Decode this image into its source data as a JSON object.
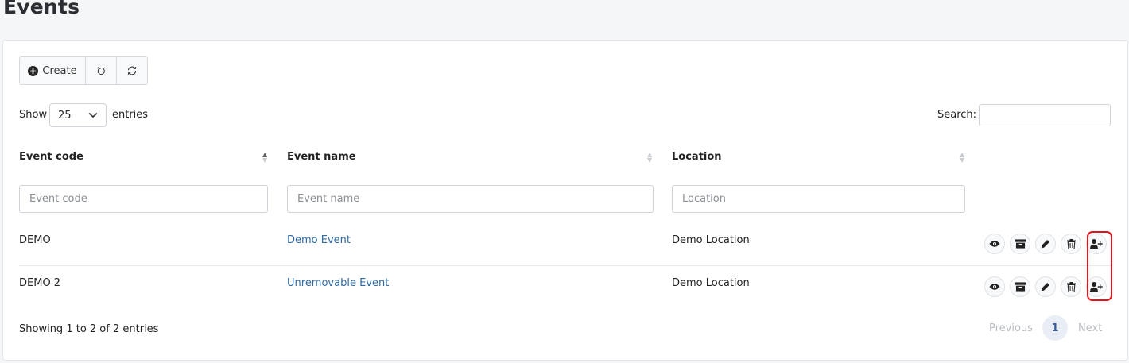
{
  "page": {
    "title": "Events"
  },
  "toolbar": {
    "create_label": "Create"
  },
  "length": {
    "show_label": "Show",
    "value": "25",
    "entries_label": "entries"
  },
  "search": {
    "label": "Search:",
    "value": ""
  },
  "columns": [
    {
      "label": "Event code",
      "placeholder": "Event code"
    },
    {
      "label": "Event name",
      "placeholder": "Event name"
    },
    {
      "label": "Location",
      "placeholder": "Location"
    }
  ],
  "rows": [
    {
      "code": "DEMO",
      "name": "Demo Event",
      "location": "Demo Location"
    },
    {
      "code": "DEMO 2",
      "name": "Unremovable Event",
      "location": "Demo Location"
    }
  ],
  "footer": {
    "info": "Showing 1 to 2 of 2 entries",
    "previous": "Previous",
    "page": "1",
    "next": "Next"
  },
  "colors": {
    "link": "#2d6aa8",
    "highlight": "#e3141c",
    "active_page_bg": "#e9edf5"
  },
  "icons": [
    "plus-circle-icon",
    "undo-icon",
    "refresh-icon",
    "sort-icon",
    "chevron-down-icon",
    "eye-icon",
    "archive-icon",
    "pencil-icon",
    "trash-icon",
    "user-plus-icon"
  ]
}
